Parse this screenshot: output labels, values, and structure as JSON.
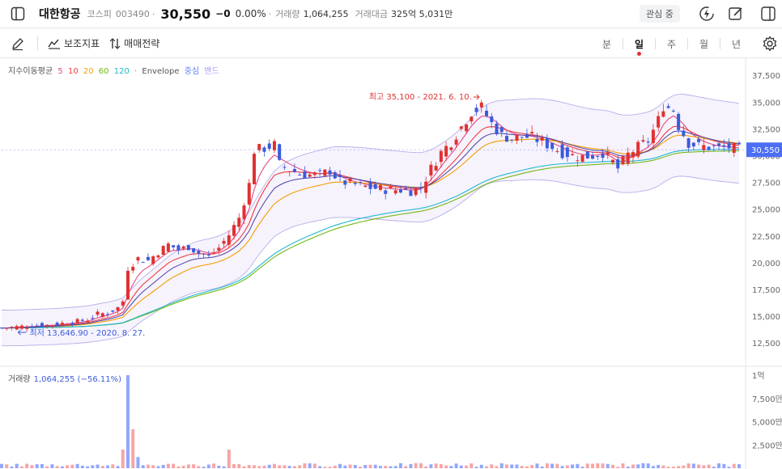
{
  "header": {
    "stock_name": "대한항공",
    "market": "코스피",
    "code": "003490",
    "sep": "·",
    "price": "30,550",
    "change": "−0",
    "change_pct": "0.00%",
    "volume_label": "거래량",
    "volume_value": "1,064,255",
    "amount_label": "거래대금",
    "amount_value": "325억 5,031만",
    "watch_label": "관심 중"
  },
  "toolbar": {
    "indicators_label": "보조지표",
    "strategy_label": "매매전략",
    "periods": [
      "분",
      "일",
      "주",
      "월",
      "년"
    ],
    "active_period": "일"
  },
  "legend": {
    "ma_label": "지수이동평균",
    "ma_periods": [
      {
        "label": "5",
        "color": "#e64980"
      },
      {
        "label": "10",
        "color": "#f03e3e"
      },
      {
        "label": "20",
        "color": "#f59f00"
      },
      {
        "label": "60",
        "color": "#74b816"
      },
      {
        "label": "120",
        "color": "#22b8cf"
      }
    ],
    "envelope_label": "Envelope",
    "envelope_center": "중심",
    "envelope_band": "밴드"
  },
  "annotations": {
    "high": "최고 35,100 - 2021. 6. 10.",
    "low": "최저 13,646.90 - 2020. 8. 27."
  },
  "price_axis": {
    "ticks": [
      "37,500",
      "35,000",
      "32,500",
      "30,000",
      "27,500",
      "25,000",
      "22,500",
      "20,000",
      "17,500",
      "15,000",
      "12,500"
    ],
    "current": "30,550"
  },
  "volume_panel": {
    "label": "거래량",
    "value": "1,064,255 (−56.11%)",
    "ticks": [
      "1억",
      "7,500만",
      "5,000만",
      "2,500만"
    ]
  },
  "colors": {
    "up": "#e03131",
    "down": "#3b5bdb",
    "ma5": "#e64980",
    "ma10": "#f03e3e",
    "ma20": "#f59f00",
    "ma60": "#74b816",
    "ma120": "#22b8cf",
    "envelope": "#9c8fe0",
    "current_tag": "#4c6ef5"
  },
  "chart_data": {
    "type": "candlestick",
    "symbol": "대한항공",
    "period": "일",
    "ylim": [
      11000,
      38500
    ],
    "high": {
      "value": 35100,
      "date": "2021. 6. 10."
    },
    "low": {
      "value": 13646.9,
      "date": "2020. 8. 27."
    },
    "current": 30550,
    "price_path": [
      [
        0,
        13900
      ],
      [
        3,
        14000
      ],
      [
        6,
        14100
      ],
      [
        10,
        14200
      ],
      [
        13,
        14400
      ],
      [
        15,
        14500
      ],
      [
        17,
        14700
      ],
      [
        19,
        15200
      ],
      [
        21,
        15300
      ],
      [
        23,
        15800
      ],
      [
        24,
        16400
      ],
      [
        25,
        19500
      ],
      [
        27,
        20400
      ],
      [
        29,
        20200
      ],
      [
        31,
        21000
      ],
      [
        33,
        21700
      ],
      [
        35,
        21200
      ],
      [
        37,
        21500
      ],
      [
        39,
        20900
      ],
      [
        41,
        20600
      ],
      [
        43,
        21400
      ],
      [
        45,
        22600
      ],
      [
        47,
        24200
      ],
      [
        49,
        27300
      ],
      [
        50,
        30500
      ],
      [
        52,
        30700
      ],
      [
        54,
        31000
      ],
      [
        55,
        29200
      ],
      [
        57,
        28700
      ],
      [
        59,
        28300
      ],
      [
        61,
        28200
      ],
      [
        63,
        28200
      ],
      [
        65,
        28600
      ],
      [
        67,
        27600
      ],
      [
        69,
        27400
      ],
      [
        71,
        27200
      ],
      [
        73,
        27000
      ],
      [
        75,
        26900
      ],
      [
        77,
        26800
      ],
      [
        79,
        26800
      ],
      [
        81,
        26700
      ],
      [
        83,
        27000
      ],
      [
        85,
        28800
      ],
      [
        87,
        30300
      ],
      [
        89,
        31300
      ],
      [
        91,
        32700
      ],
      [
        93,
        34100
      ],
      [
        95,
        34500
      ],
      [
        97,
        33000
      ],
      [
        99,
        31900
      ],
      [
        101,
        31600
      ],
      [
        103,
        31800
      ],
      [
        105,
        31700
      ],
      [
        107,
        31300
      ],
      [
        109,
        30800
      ],
      [
        111,
        30300
      ],
      [
        113,
        30000
      ],
      [
        115,
        29900
      ],
      [
        117,
        30000
      ],
      [
        119,
        30300
      ],
      [
        121,
        29400
      ],
      [
        122,
        28800
      ],
      [
        124,
        30100
      ],
      [
        126,
        30800
      ],
      [
        128,
        31400
      ],
      [
        130,
        33300
      ],
      [
        131,
        34700
      ],
      [
        133,
        34300
      ],
      [
        134,
        32800
      ],
      [
        136,
        31200
      ],
      [
        138,
        30900
      ],
      [
        140,
        30800
      ],
      [
        142,
        30700
      ],
      [
        144,
        30800
      ],
      [
        146,
        30550
      ]
    ],
    "volume_spikes": [
      {
        "x": 25,
        "value": 100000000
      },
      {
        "x": 26,
        "value": 42000000
      },
      {
        "x": 24,
        "value": 20000000
      },
      {
        "x": 45,
        "value": 20000000
      },
      {
        "x": 27,
        "value": 12000000
      }
    ]
  }
}
